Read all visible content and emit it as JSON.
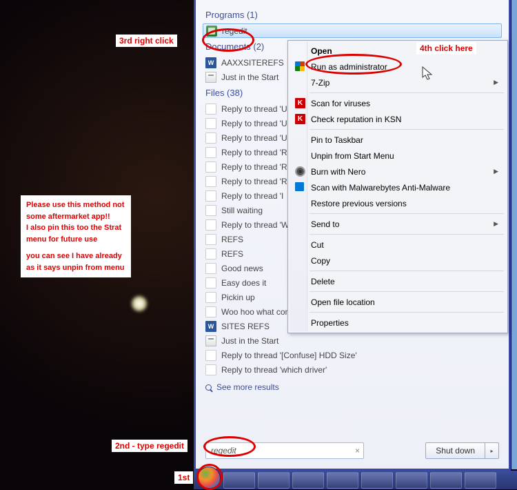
{
  "sections": {
    "programs": {
      "label": "Programs (1)"
    },
    "documents": {
      "label": "Documents (2)"
    },
    "files": {
      "label": "Files (38)"
    }
  },
  "programs": [
    {
      "label": "regedit",
      "iconClass": "icon-regedit"
    }
  ],
  "documents": [
    {
      "label": "AAXXSITEREFS",
      "iconClass": "icon-word",
      "iconText": "W"
    },
    {
      "label": "Just in the Start",
      "iconClass": "icon-script"
    }
  ],
  "files": [
    {
      "label": "Reply to thread 'U",
      "iconClass": "icon-page"
    },
    {
      "label": "Reply to thread 'U",
      "iconClass": "icon-page"
    },
    {
      "label": "Reply to thread 'U",
      "iconClass": "icon-page"
    },
    {
      "label": "Reply to thread 'R",
      "iconClass": "icon-page"
    },
    {
      "label": "Reply to thread 'R",
      "iconClass": "icon-page"
    },
    {
      "label": "Reply to thread 'R",
      "iconClass": "icon-page"
    },
    {
      "label": "Reply to thread 'I",
      "iconClass": "icon-page"
    },
    {
      "label": "Still waiting",
      "iconClass": "icon-page"
    },
    {
      "label": "Reply to thread 'W",
      "iconClass": "icon-page"
    },
    {
      "label": "REFS",
      "iconClass": "icon-page"
    },
    {
      "label": "REFS",
      "iconClass": "icon-page"
    },
    {
      "label": "Good news",
      "iconClass": "icon-page"
    },
    {
      "label": "Easy does it",
      "iconClass": "icon-page"
    },
    {
      "label": "Pickin up",
      "iconClass": "icon-page"
    },
    {
      "label": "Woo hoo what compliment!!",
      "iconClass": "icon-page"
    },
    {
      "label": "SITES REFS",
      "iconClass": "icon-word",
      "iconText": "W"
    },
    {
      "label": "Just in the Start",
      "iconClass": "icon-script"
    },
    {
      "label": "Reply to thread '[Confuse] HDD Size'",
      "iconClass": "icon-page"
    },
    {
      "label": "Reply to thread 'which driver'",
      "iconClass": "icon-page"
    }
  ],
  "seeMore": "See more results",
  "searchValue": "regedit",
  "shutdownLabel": "Shut down",
  "contextMenu": [
    {
      "label": "Open",
      "bold": true
    },
    {
      "label": "Run as administrator",
      "iconClass": "icon-shield"
    },
    {
      "label": "7-Zip",
      "hasArrow": true
    },
    {
      "sep": true
    },
    {
      "label": "Scan for viruses",
      "iconClass": "icon-k",
      "iconText": "K"
    },
    {
      "label": "Check reputation in KSN",
      "iconClass": "icon-k",
      "iconText": "K"
    },
    {
      "sep": true
    },
    {
      "label": "Pin to Taskbar"
    },
    {
      "label": "Unpin from Start Menu"
    },
    {
      "label": "Burn with Nero",
      "iconClass": "icon-nero",
      "hasArrow": true
    },
    {
      "label": "Scan with Malwarebytes Anti-Malware",
      "iconClass": "icon-malware"
    },
    {
      "label": "Restore previous versions"
    },
    {
      "sep": true
    },
    {
      "label": "Send to",
      "hasArrow": true
    },
    {
      "sep": true
    },
    {
      "label": "Cut"
    },
    {
      "label": "Copy"
    },
    {
      "sep": true
    },
    {
      "label": "Delete"
    },
    {
      "sep": true
    },
    {
      "label": "Open file location"
    },
    {
      "sep": true
    },
    {
      "label": "Properties"
    }
  ],
  "annotations": {
    "a1": "1st",
    "a2": "2nd - type regedit",
    "a3": "3rd right click",
    "a4": "4th click here",
    "note1": "Please use this method not some aftermarket app!!\nI also pin this too the Strat menu for future use",
    "note2": "you can see I have already as it says unpin from menu"
  }
}
